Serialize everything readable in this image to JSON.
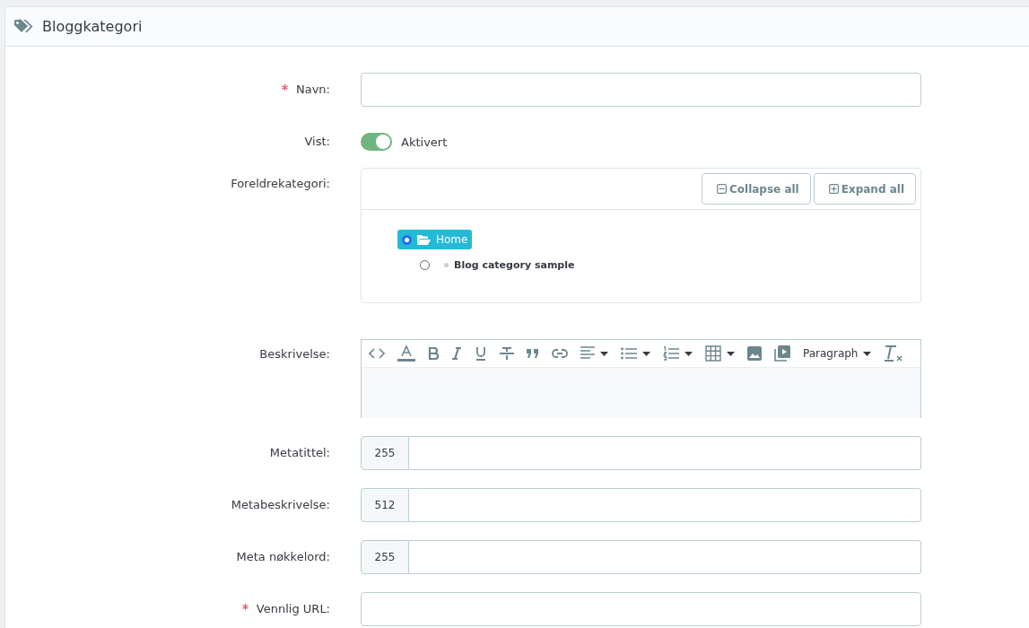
{
  "panel": {
    "title": "Bloggkategori"
  },
  "fields": [
    {
      "kind": "text",
      "label": "Navn:",
      "required": true
    },
    {
      "kind": "switch",
      "label": "Vist:",
      "required": false,
      "on": true,
      "state_label": "Aktivert"
    },
    {
      "kind": "tree",
      "label": "Foreldrekategori:",
      "required": false,
      "buttons": [
        {
          "kind": "collapse",
          "label": "Collapse all"
        },
        {
          "kind": "expand",
          "label": "Expand all"
        }
      ],
      "tree": [
        {
          "label": "Home",
          "selected": true,
          "expanded": true,
          "children": [
            {
              "label": "Blog category sample",
              "selected": false
            }
          ]
        }
      ]
    },
    {
      "kind": "editor",
      "label": "Beskrivelse:",
      "required": false,
      "format": "Paragraph"
    },
    {
      "kind": "counted",
      "label": "Metatittel:",
      "required": false,
      "count": "255"
    },
    {
      "kind": "counted",
      "label": "Metabeskrivelse:",
      "required": false,
      "count": "512"
    },
    {
      "kind": "counted",
      "label": "Meta nøkkelord:",
      "required": false,
      "count": "255"
    },
    {
      "kind": "text",
      "label": "Vennlig URL:",
      "required": true
    }
  ]
}
